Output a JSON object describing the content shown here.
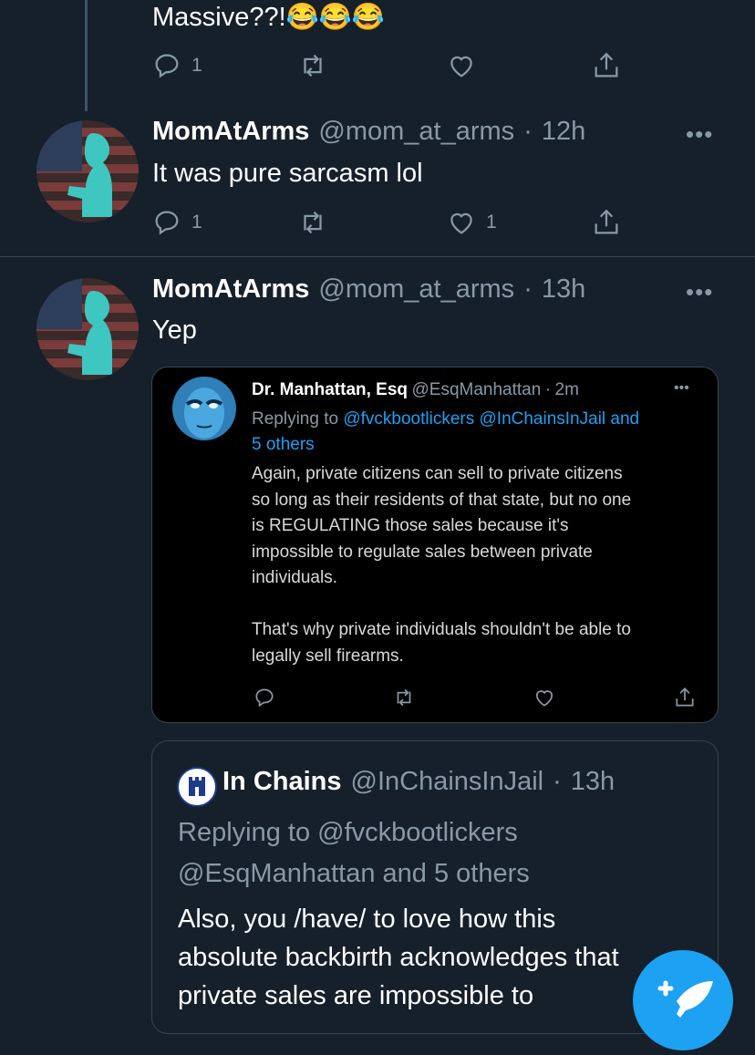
{
  "prev_tweet": {
    "text": "Massive??!😂😂😂",
    "reply_count": "1",
    "retweet_count": "",
    "like_count": ""
  },
  "tweet1": {
    "name": "MomAtArms",
    "handle": "@mom_at_arms",
    "sep": "·",
    "time": "12h",
    "text": "It was pure sarcasm lol",
    "reply_count": "1",
    "retweet_count": "",
    "like_count": "1",
    "more": "•••"
  },
  "tweet2": {
    "name": "MomAtArms",
    "handle": "@mom_at_arms",
    "sep": "·",
    "time": "13h",
    "text": "Yep",
    "more": "•••",
    "quoted": {
      "name": "Dr. Manhattan, Esq",
      "handle": "@EsqManhattan",
      "sep": "·",
      "time": "2m",
      "more": "•••",
      "replying_prefix": "Replying to ",
      "replying_users": "@fvckbootlickers @InChainsInJail",
      "replying_and": " and",
      "replying_others": "5 others",
      "body": "Again, private citizens can sell to private citizens\nso long as their residents of that state, but no one\nis REGULATING those sales because it's\nimpossible to regulate sales between private\nindividuals.\n\nThat's why private individuals shouldn't be able to\nlegally sell firearms."
    },
    "quoted2": {
      "name": "In Chains",
      "handle": "@InChainsInJail",
      "sep": "·",
      "time": "13h",
      "replying_line1": "Replying to @fvckbootlickers",
      "replying_line2": "@EsqManhattan and 5 others",
      "body_line1": "Also, you /have/ to love how this",
      "body_line2": "absolute backbirth acknowledges that",
      "body_line3": "private sales are impossible to"
    }
  },
  "colors": {
    "background": "#15202b",
    "secondary_text": "#8899a6",
    "accent": "#1da1f2",
    "divider": "#38444d"
  },
  "icons": {
    "reply": "reply-icon",
    "retweet": "retweet-icon",
    "like": "heart-icon",
    "share": "share-icon",
    "compose": "compose-tweet-icon"
  }
}
